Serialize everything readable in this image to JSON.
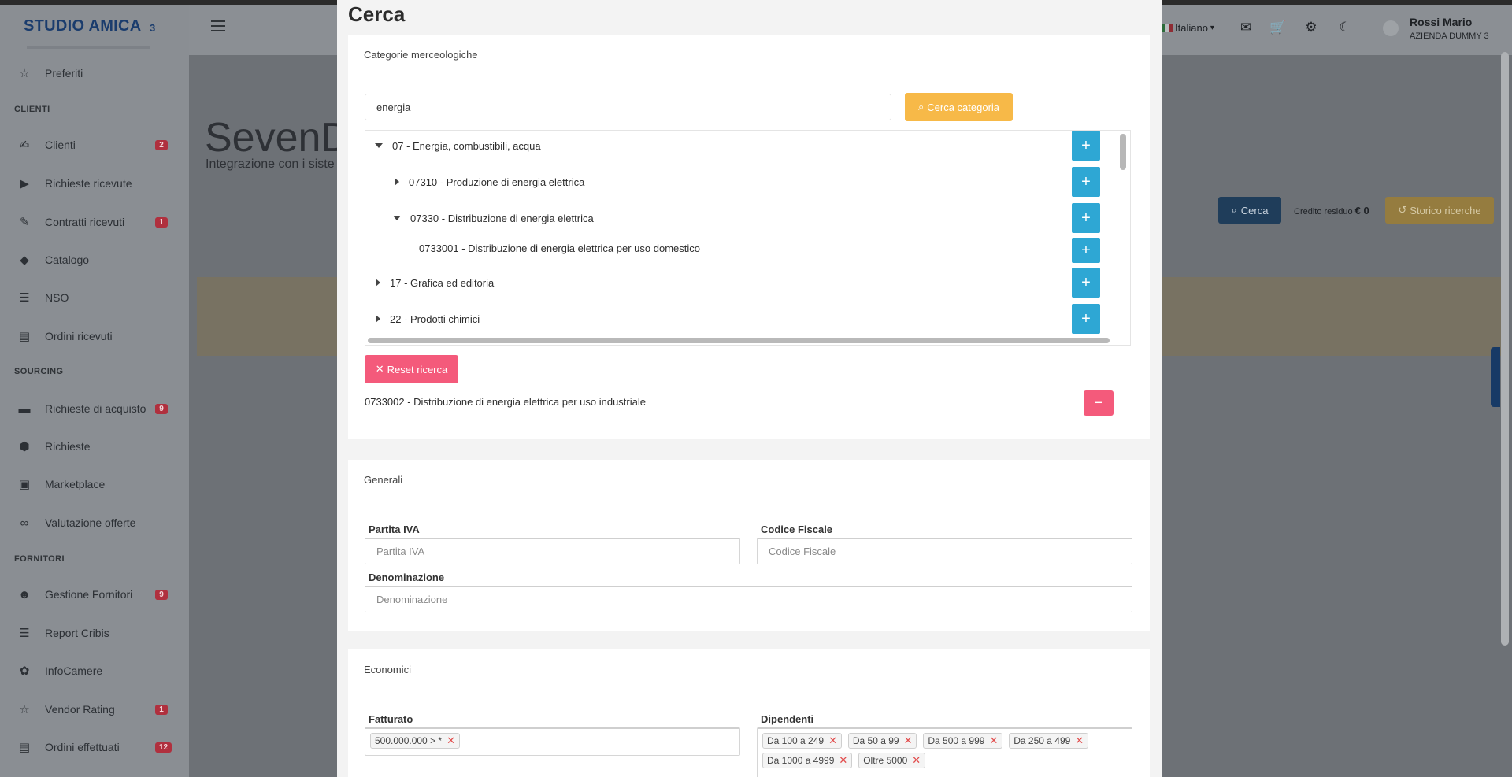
{
  "brand": {
    "name": "STUDIO AMICA",
    "num": "3"
  },
  "sidebar": {
    "sections": [
      {
        "label": "CLIENTI"
      },
      {
        "label": "SOURCING"
      },
      {
        "label": "FORNITORI"
      }
    ],
    "items": [
      {
        "label": "Preferiti",
        "icon": "star-icon",
        "badge": ""
      },
      {
        "label": "Clienti",
        "icon": "handshake-icon",
        "badge": "2"
      },
      {
        "label": "Richieste ricevute",
        "icon": "circle-play-icon",
        "badge": ""
      },
      {
        "label": "Contratti ricevuti",
        "icon": "contract-icon",
        "badge": "1"
      },
      {
        "label": "Catalogo",
        "icon": "tags-icon",
        "badge": ""
      },
      {
        "label": "NSO",
        "icon": "list-icon",
        "badge": ""
      },
      {
        "label": "Ordini ricevuti",
        "icon": "receipt-icon",
        "badge": ""
      },
      {
        "label": "Richieste di acquisto",
        "icon": "card-icon",
        "badge": "9"
      },
      {
        "label": "Richieste",
        "icon": "box-icon",
        "badge": ""
      },
      {
        "label": "Marketplace",
        "icon": "shopping-bag-icon",
        "badge": ""
      },
      {
        "label": "Valutazione offerte",
        "icon": "glasses-icon",
        "badge": ""
      },
      {
        "label": "Gestione Fornitori",
        "icon": "users-icon",
        "badge": "9"
      },
      {
        "label": "Report Cribis",
        "icon": "cribis-logo-icon",
        "badge": ""
      },
      {
        "label": "InfoCamere",
        "icon": "infocamere-icon",
        "badge": ""
      },
      {
        "label": "Vendor Rating",
        "icon": "star-icon",
        "badge": "1"
      },
      {
        "label": "Ordini effettuati",
        "icon": "receipt-icon",
        "badge": "12"
      }
    ]
  },
  "header": {
    "language": "Italiano",
    "user_name": "Rossi Mario",
    "user_company": "AZIENDA DUMMY 3"
  },
  "page": {
    "title": "SevenD",
    "subtitle": "Integrazione con i siste",
    "cerca_label": "Cerca",
    "credit_label": "Credito residuo",
    "credit_value": "€ 0",
    "storico_label": "Storico ricerche"
  },
  "modal": {
    "title": "Cerca",
    "categories": {
      "title": "Categorie merceologiche",
      "search_value": "energia",
      "search_button": "Cerca categoria",
      "tree": [
        {
          "label": "07 - Energia, combustibili, acqua",
          "state": "expanded"
        },
        {
          "label": "07310 - Produzione di energia elettrica",
          "state": "collapsed"
        },
        {
          "label": "07330 - Distribuzione di energia elettrica",
          "state": "expanded"
        },
        {
          "label": "0733001 - Distribuzione di energia elettrica per uso domestico",
          "state": "leaf"
        },
        {
          "label": "17 - Grafica ed editoria",
          "state": "collapsed"
        },
        {
          "label": "22 - Prodotti chimici",
          "state": "collapsed"
        }
      ],
      "reset_button": "Reset ricerca",
      "selected": "0733002 - Distribuzione di energia elettrica per uso industriale"
    },
    "generali": {
      "title": "Generali",
      "piva_label": "Partita IVA",
      "piva_placeholder": "Partita IVA",
      "cf_label": "Codice Fiscale",
      "cf_placeholder": "Codice Fiscale",
      "den_label": "Denominazione",
      "den_placeholder": "Denominazione"
    },
    "economici": {
      "title": "Economici",
      "fatturato_label": "Fatturato",
      "fatturato_tags": [
        "500.000.000 > *"
      ],
      "dipendenti_label": "Dipendenti",
      "dipendenti_tags": [
        "Da 100 a 249",
        "Da 50 a 99",
        "Da 500 a 999",
        "Da 250 a 499",
        "Da 1000 a 4999",
        "Oltre 5000"
      ]
    }
  }
}
